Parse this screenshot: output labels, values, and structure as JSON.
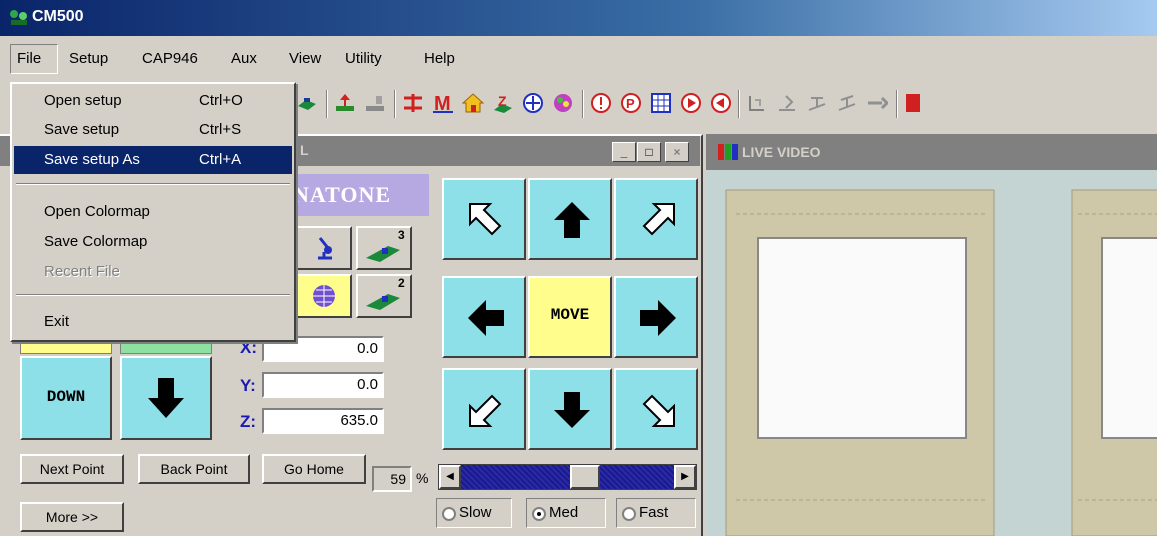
{
  "app": {
    "title": "CM500"
  },
  "menubar": {
    "items": [
      "File",
      "Setup",
      "CAP946",
      "Aux",
      "View",
      "Utility",
      "Help"
    ]
  },
  "file_menu": {
    "items": [
      {
        "label": "Open setup",
        "shortcut": "Ctrl+O"
      },
      {
        "label": "Save setup",
        "shortcut": "Ctrl+S"
      },
      {
        "label": "Save setup As",
        "shortcut": "Ctrl+A"
      },
      {
        "label": "Open Colormap"
      },
      {
        "label": "Save Colormap"
      },
      {
        "label": "Recent File"
      },
      {
        "label": "Exit"
      }
    ]
  },
  "control_panel": {
    "title_fragment": "L",
    "brand": "NATONE",
    "down_label": "DOWN",
    "move_label": "MOVE",
    "icon_badges": {
      "top": "3",
      "bottom": "2"
    },
    "coords": {
      "x_label": "X:",
      "x": "0.0",
      "y_label": "Y:",
      "y": "0.0",
      "z_label": "Z:",
      "z": "635.0"
    },
    "buttons": {
      "next": "Next Point",
      "back": "Back Point",
      "home": "Go Home",
      "more": "More >>"
    },
    "speed": {
      "value": "59",
      "unit": "%",
      "slider_fraction": 0.59
    },
    "speed_modes": {
      "slow": "Slow",
      "med": "Med",
      "fast": "Fast",
      "selected": "Med"
    }
  },
  "video": {
    "title": "LIVE VIDEO"
  },
  "colors": {
    "pad_cyan": "#8ee0e8",
    "move_yellow": "#fffe8c",
    "brand_lavender": "#b6a8e0",
    "menu_highlight": "#0a246a"
  }
}
